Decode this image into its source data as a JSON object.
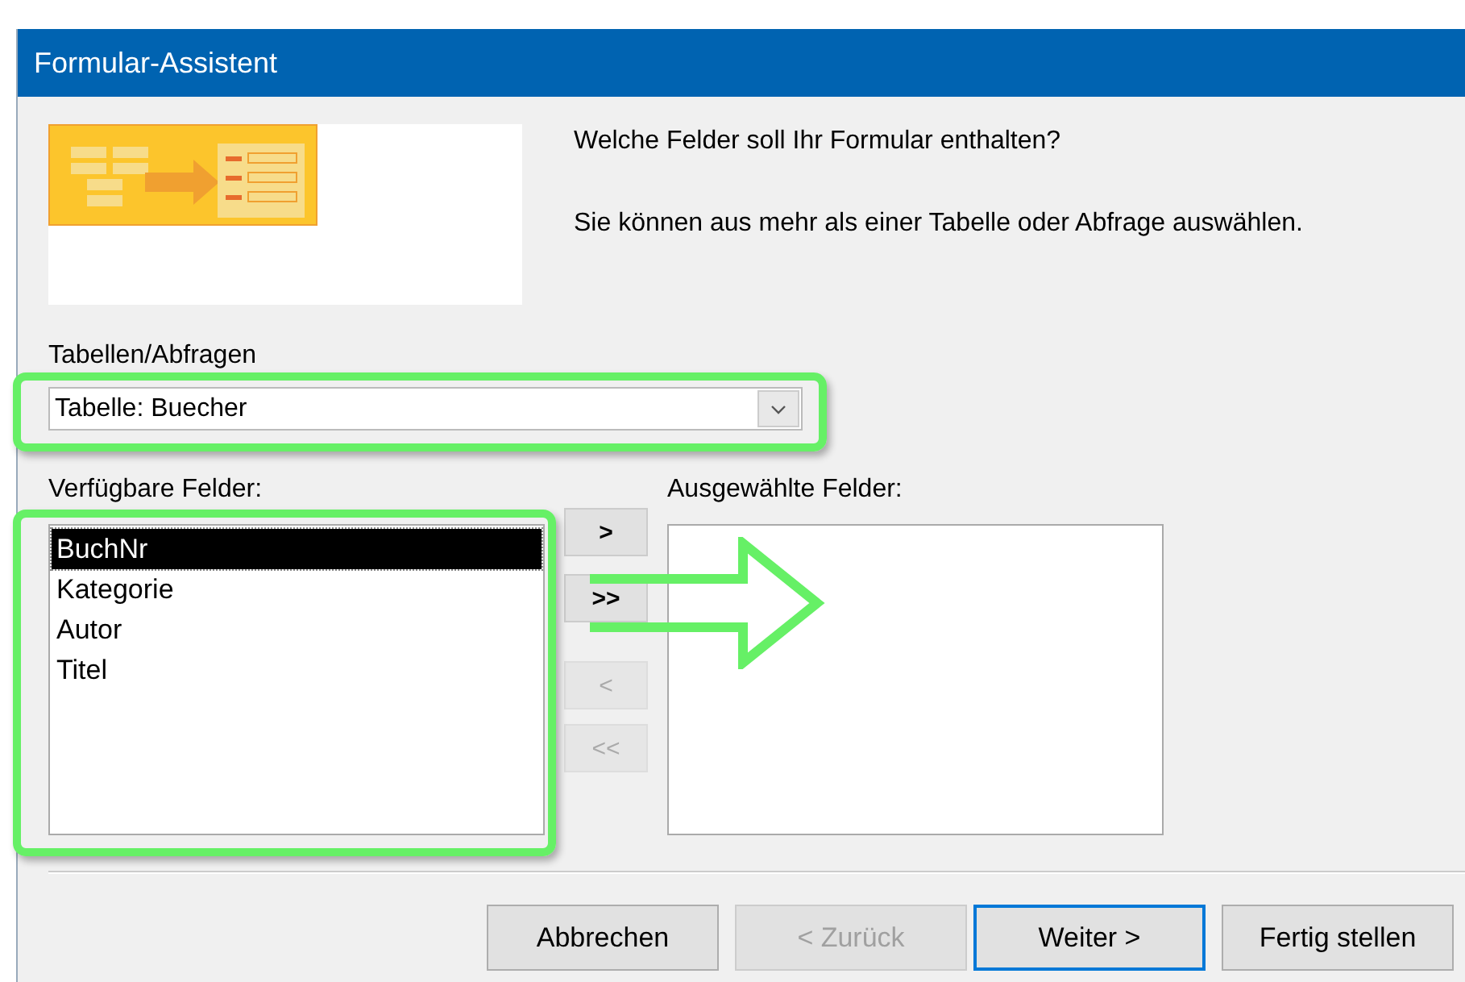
{
  "window": {
    "title": "Formular-Assistent"
  },
  "intro": [
    "Welche Felder soll Ihr Formular enthalten?",
    "Sie können aus mehr als einer Tabelle oder Abfrage auswählen."
  ],
  "source": {
    "label": "Tabellen/Abfragen",
    "value": "Tabelle: Buecher",
    "highlighted": true
  },
  "available": {
    "label": "Verfügbare Felder:",
    "highlighted": true,
    "items": [
      {
        "text": "BuchNr",
        "selected": true
      },
      {
        "text": "Kategorie",
        "selected": false
      },
      {
        "text": "Autor",
        "selected": false
      },
      {
        "text": "Titel",
        "selected": false
      }
    ]
  },
  "move_buttons": [
    {
      "label": ">",
      "disabled": false
    },
    {
      "label": ">>",
      "disabled": false
    },
    {
      "label": "<",
      "disabled": true
    },
    {
      "label": "<<",
      "disabled": true
    }
  ],
  "selected_fields": {
    "label": "Ausgewählte Felder:"
  },
  "arrow_annotation": true,
  "buttons": [
    {
      "label": "Abbrechen",
      "disabled": false,
      "default": false
    },
    {
      "label": "< Zurück",
      "disabled": true,
      "default": false
    },
    {
      "label": "Weiter >",
      "disabled": false,
      "default": true
    },
    {
      "label": "Fertig stellen",
      "disabled": false,
      "default": false
    }
  ]
}
